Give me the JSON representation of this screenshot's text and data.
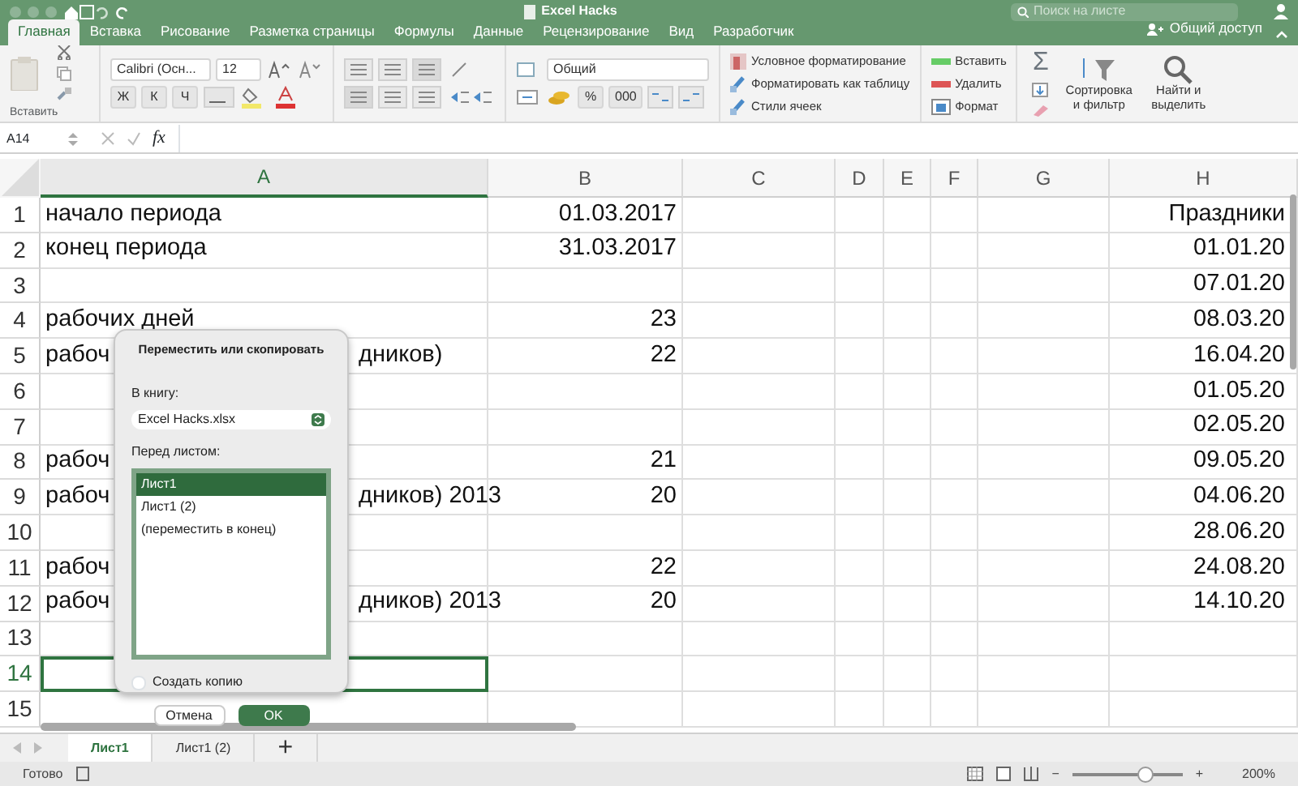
{
  "window": {
    "title": "Excel Hacks",
    "search_placeholder": "Поиск на листе"
  },
  "ribbon_tabs": [
    {
      "label": "Главная",
      "selected": true
    },
    {
      "label": "Вставка",
      "selected": false
    },
    {
      "label": "Рисование",
      "selected": false
    },
    {
      "label": "Разметка страницы",
      "selected": false
    },
    {
      "label": "Формулы",
      "selected": false
    },
    {
      "label": "Данные",
      "selected": false
    },
    {
      "label": "Рецензирование",
      "selected": false
    },
    {
      "label": "Вид",
      "selected": false
    },
    {
      "label": "Разработчик",
      "selected": false
    }
  ],
  "share_button": "Общий доступ",
  "ribbon": {
    "paste_label": "Вставить",
    "font_name": "Calibri (Осн...",
    "font_size": "12",
    "bold": "Ж",
    "italic": "К",
    "underline": "Ч",
    "number_format": "Общий",
    "percent": "%",
    "thousands": "000",
    "styles": [
      "Условное форматирование",
      "Форматировать как таблицу",
      "Стили ячеек"
    ],
    "cells": [
      "Вставить",
      "Удалить",
      "Формат"
    ],
    "autosum": "Σ",
    "sort_filter": "Сортировка и фильтр",
    "find_select": "Найти и выделить"
  },
  "formula_bar": {
    "name_box": "A14",
    "fx": "fx"
  },
  "sheet": {
    "columns": [
      "A",
      "B",
      "C",
      "D",
      "E",
      "F",
      "G",
      "H"
    ],
    "rows": [
      {
        "number": "1",
        "a": [
          "начало периода"
        ],
        "b": "01.03.2017",
        "h": "Праздники",
        "selected": false
      },
      {
        "number": "2",
        "a": [
          "конец периода"
        ],
        "b": "31.03.2017",
        "h": "01.01.20",
        "selected": false
      },
      {
        "number": "3",
        "a": [],
        "b": "",
        "h": "07.01.20",
        "selected": false
      },
      {
        "number": "4",
        "a": [
          "рабочих дней"
        ],
        "b": "23",
        "h": "08.03.20",
        "selected": false
      },
      {
        "number": "5",
        "a": [
          "рабоч",
          "дников)"
        ],
        "b": "22",
        "h": "16.04.20",
        "selected": false
      },
      {
        "number": "6",
        "a": [],
        "b": "",
        "h": "01.05.20",
        "selected": false
      },
      {
        "number": "7",
        "a": [],
        "b": "",
        "h": "02.05.20",
        "selected": false
      },
      {
        "number": "8",
        "a": [
          "рабоч"
        ],
        "b": "21",
        "h": "09.05.20",
        "selected": false
      },
      {
        "number": "9",
        "a": [
          "рабоч",
          "дников) 2013"
        ],
        "b": "20",
        "h": "04.06.20",
        "selected": false
      },
      {
        "number": "10",
        "a": [],
        "b": "",
        "h": "28.06.20",
        "selected": false
      },
      {
        "number": "11",
        "a": [
          "рабоч"
        ],
        "b": "22",
        "h": "24.08.20",
        "selected": false
      },
      {
        "number": "12",
        "a": [
          "рабоч",
          "дников) 2013"
        ],
        "b": "20",
        "h": "14.10.20",
        "selected": false
      },
      {
        "number": "13",
        "a": [],
        "b": "",
        "h": "",
        "selected": false
      },
      {
        "number": "14",
        "a": [],
        "b": "",
        "h": "",
        "selected": true
      },
      {
        "number": "15",
        "a": [],
        "b": "",
        "h": "",
        "selected": false
      }
    ]
  },
  "dialog": {
    "title": "Переместить или скопировать",
    "book_label": "В книгу:",
    "book": "Excel Hacks.xlsx",
    "before_label": "Перед листом:",
    "sheets": [
      {
        "label": "Лист1",
        "selected": true
      },
      {
        "label": "Лист1 (2)",
        "selected": false
      },
      {
        "label": "(переместить в конец)",
        "selected": false
      }
    ],
    "copy": {
      "label": "Создать копию",
      "checked": false
    },
    "buttons": [
      {
        "label": "Отмена",
        "kind": "secondary"
      },
      {
        "label": "OK",
        "kind": "primary"
      }
    ]
  },
  "sheet_tabs": [
    {
      "label": "Лист1",
      "selected": true
    },
    {
      "label": "Лист1 (2)",
      "selected": false
    }
  ],
  "add_sheet": "+",
  "status_bar": {
    "text": "Готово",
    "zoom_out": "−",
    "zoom_in": "+",
    "zoom_slider": {
      "level": 0.66
    },
    "zoom": "200%"
  }
}
